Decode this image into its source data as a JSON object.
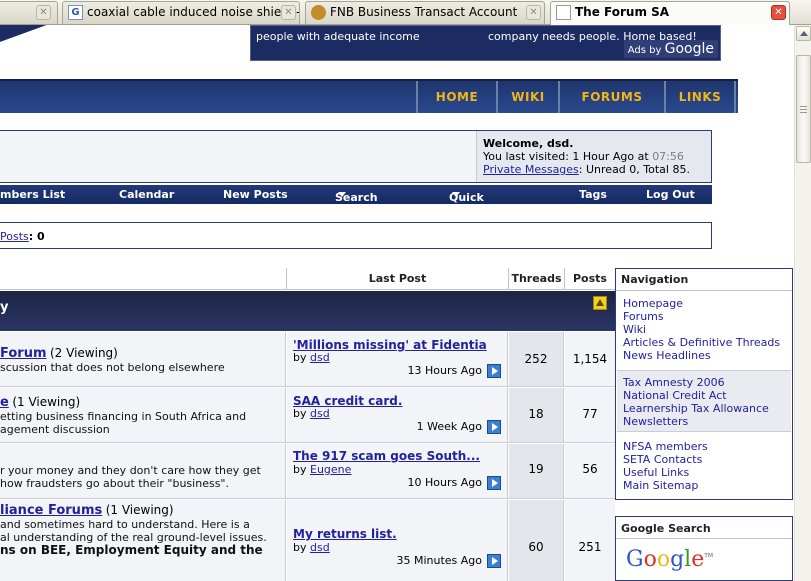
{
  "tabs": [
    {
      "title": "",
      "close": "x"
    },
    {
      "title": "coaxial cable induced noise shield - G...",
      "close": "x"
    },
    {
      "title": "FNB Business Transact Account",
      "close": "x"
    },
    {
      "title": "The Forum SA",
      "close": "x"
    }
  ],
  "ad": {
    "left_text": "people with adequate income",
    "right_text": "company needs people. Home based!",
    "ads_by": "Ads by",
    "google": "Google"
  },
  "nav": [
    "HOME",
    "WIKI",
    "FORUMS",
    "LINKS"
  ],
  "welcome": {
    "title": "Welcome, dsd.",
    "last_visit_label": "You last visited: 1 Hour Ago at",
    "last_visit_time": "07:56",
    "pm_link": "Private Messages",
    "pm_stats": ": Unread 0, Total 85."
  },
  "menubar": {
    "members": "mbers List",
    "calendar": "Calendar",
    "new_posts": "New Posts",
    "search": "Search",
    "quick_links": "Quick Links",
    "tags": "Tags",
    "logout": "Log Out"
  },
  "stats": {
    "posts_link": "Posts",
    "posts_value": ": 0"
  },
  "table": {
    "headers": {
      "last_post": "Last Post",
      "threads": "Threads",
      "posts": "Posts"
    },
    "category": "y",
    "rows": [
      {
        "forum_name": "Forum",
        "viewing": "(2 Viewing)",
        "desc1": "scussion that does not belong elsewhere",
        "desc2": "",
        "desc3": "",
        "last_title": "'Millions missing' at Fidentia",
        "by": "by",
        "last_user": "dsd",
        "last_time": "13 Hours Ago",
        "threads": "252",
        "posts": "1,154"
      },
      {
        "forum_name": "e",
        "viewing": "(1 Viewing)",
        "desc1": "etting business financing in South Africa and",
        "desc2": "agement discussion",
        "desc3": "",
        "last_title": "SAA credit card.",
        "by": "by",
        "last_user": "dsd",
        "last_time": "1 Week Ago",
        "threads": "18",
        "posts": "77"
      },
      {
        "forum_name": "",
        "viewing": "",
        "desc1": "r your money and they don't care how they get",
        "desc2": "how fraudsters go about their \"business\".",
        "desc3": "",
        "last_title": "The 917 scam goes South...",
        "by": "by",
        "last_user": "Eugene",
        "last_time": "10 Hours Ago",
        "threads": "19",
        "posts": "56"
      },
      {
        "forum_name": "liance Forums",
        "viewing": "(1 Viewing)",
        "desc1": "and sometimes hard to understand. Here is a",
        "desc2": "al understanding of the real ground-level issues.",
        "desc3": "ns on BEE, Employment Equity and the",
        "last_title": "My returns list.",
        "by": "by",
        "last_user": "dsd",
        "last_time": "35 Minutes Ago",
        "threads": "60",
        "posts": "251"
      }
    ]
  },
  "navigation": {
    "title": "Navigation",
    "group1": [
      "Homepage",
      "Forums",
      "Wiki",
      "Articles & Definitive Threads",
      "News Headlines"
    ],
    "group2": [
      "Tax Amnesty 2006",
      "National Credit Act",
      "Learnership Tax Allowance",
      "Newsletters"
    ],
    "group3": [
      "NFSA members",
      "SETA Contacts",
      "Useful Links",
      "Main Sitemap"
    ]
  },
  "google_search": {
    "title": "Google Search",
    "logo": "Google",
    "tm": "TM"
  },
  "colors": {
    "nav_gold": "#f2b418",
    "nav_blue": "#1f356e",
    "link": "#22229c"
  }
}
